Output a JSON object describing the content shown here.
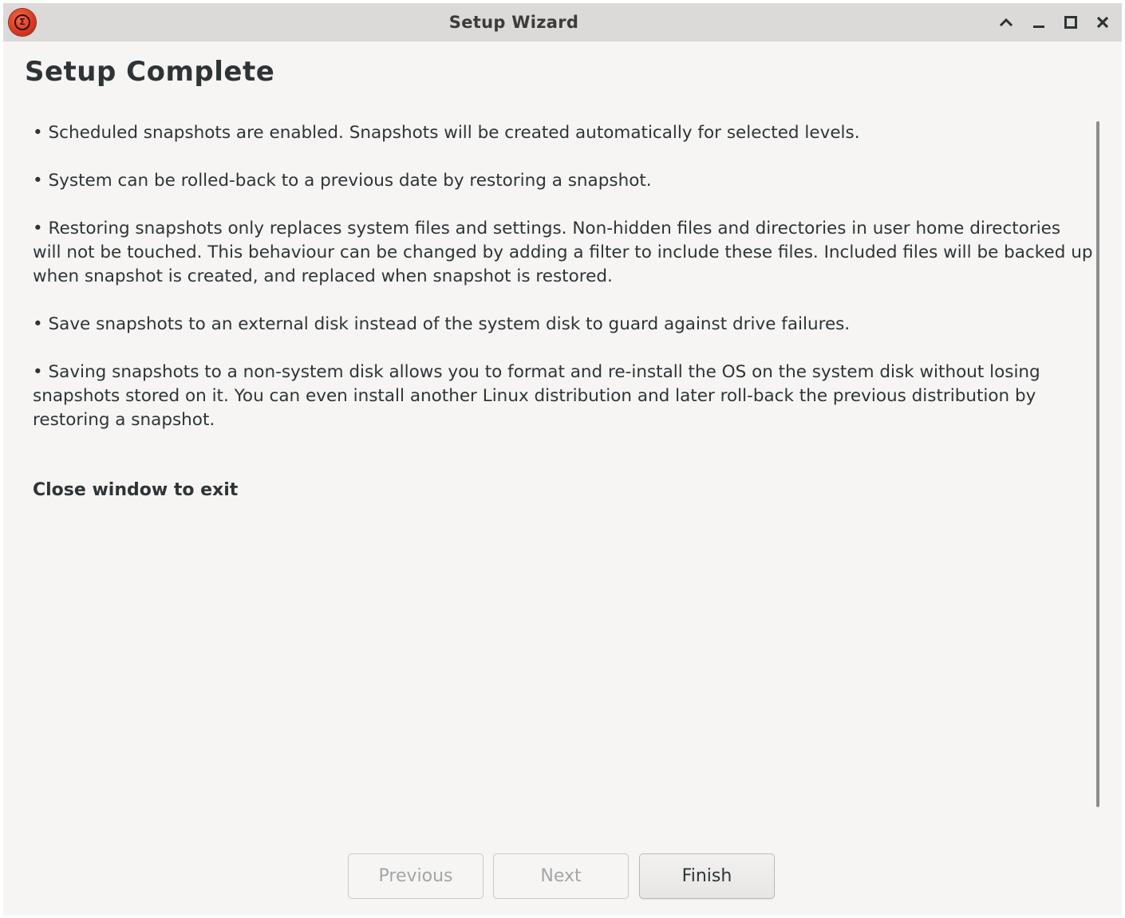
{
  "window": {
    "title": "Setup Wizard"
  },
  "page": {
    "heading": "Setup Complete",
    "paragraphs": [
      "• Scheduled snapshots are enabled. Snapshots will be created automatically for selected levels.",
      "• System can be rolled-back to a previous date by restoring a snapshot.",
      "• Restoring snapshots only replaces system files and settings. Non-hidden files and directories in user home directories will not be touched. This behaviour can be changed by adding a filter to include these files. Included files will be backed up when snapshot is created, and replaced when snapshot is restored.",
      "• Save snapshots to an external disk instead of the system disk to guard against drive failures.",
      "• Saving snapshots to a non-system disk allows you to format and re-install the OS on the system disk without losing snapshots stored on it. You can even install another Linux distribution and later roll-back the previous distribution by restoring a snapshot."
    ],
    "exit_note": "Close window to exit"
  },
  "footer": {
    "previous_label": "Previous",
    "next_label": "Next",
    "finish_label": "Finish"
  },
  "icons": {
    "app": "timeshift-app-icon",
    "shade": "chevron-up-icon",
    "minimize": "minimize-icon",
    "maximize": "maximize-icon",
    "close": "close-icon"
  },
  "colors": {
    "titlebar": "#dcdad8",
    "window_bg": "#f6f5f4",
    "text": "#2e3436",
    "disabled_text": "#a3a6a7",
    "app_icon": "#d9371f"
  }
}
